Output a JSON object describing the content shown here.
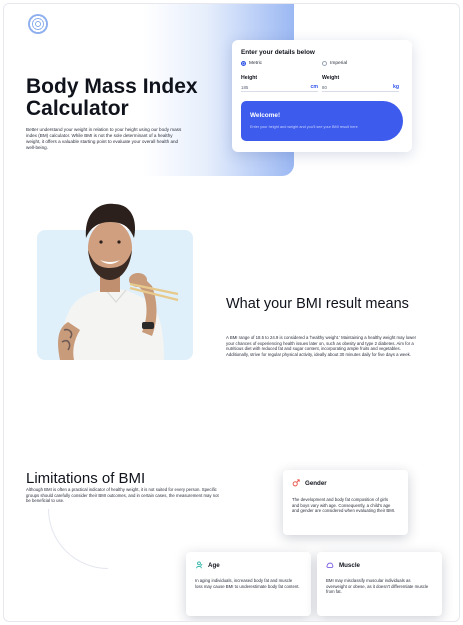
{
  "hero": {
    "title": "Body Mass Index Calculator",
    "intro": "Better understand your weight in relation to your height using our body mass index (BM) calculator. While BMI is not the sole determinant of a healthy weight, it offers a valuable starting point to evaluate your overall health and well-being."
  },
  "calculator": {
    "title": "Enter your details below",
    "metric_label": "Metric",
    "imperial_label": "Imperial",
    "selected_unit": "Metric",
    "height_label": "Height",
    "height_value": "185",
    "height_unit": "cm",
    "weight_label": "Weight",
    "weight_value": "80",
    "weight_unit": "kg",
    "welcome_title": "Welcome!",
    "welcome_text": "Enter your height and weight and you'll see your BMI result here"
  },
  "result": {
    "title": "What your BMI result means",
    "text": "A BMI range of 18.5 to 24.9 is considered a 'healthy weight.' Maintaining a healthy weight may lower your chances of experiencing health issues later on, such as obesity and type 2 diabetes. Aim for a nutritious diet with reduced fat and sugar content, incorporating ample fruits and vegetables. Additionally, strive for regular physical activity, ideally about 30 minutes daily for five days a week."
  },
  "limitations": {
    "title": "Limitations of BMI",
    "text": "Although BMI is often a practical indicator of healthy weight, it is not suited for every person. Specific groups should carefully consider their BMI outcomes, and in certain cases, the measurement may not be beneficial to use.",
    "cards": [
      {
        "title": "Gender",
        "icon": "gender-icon",
        "text": "The development and body fat composition of girls and boys vary with age. Consequently, a child's age and gender are considered when evaluating their BMI."
      },
      {
        "title": "Age",
        "icon": "age-icon",
        "text": "In aging individuals, increased body fat and muscle loss may cause BMI to underestimate body fat content."
      },
      {
        "title": "Muscle",
        "icon": "muscle-icon",
        "text": "BMI may misclassify muscular individuals as overweight or obese, as it doesn't differentiate muscle from fat."
      }
    ]
  },
  "colors": {
    "accent": "#3d5bec",
    "photo_bg": "#dff0fb",
    "gender_icon": "#e8574a",
    "age_icon": "#2bb3a6",
    "muscle_icon": "#7b5fe0"
  }
}
